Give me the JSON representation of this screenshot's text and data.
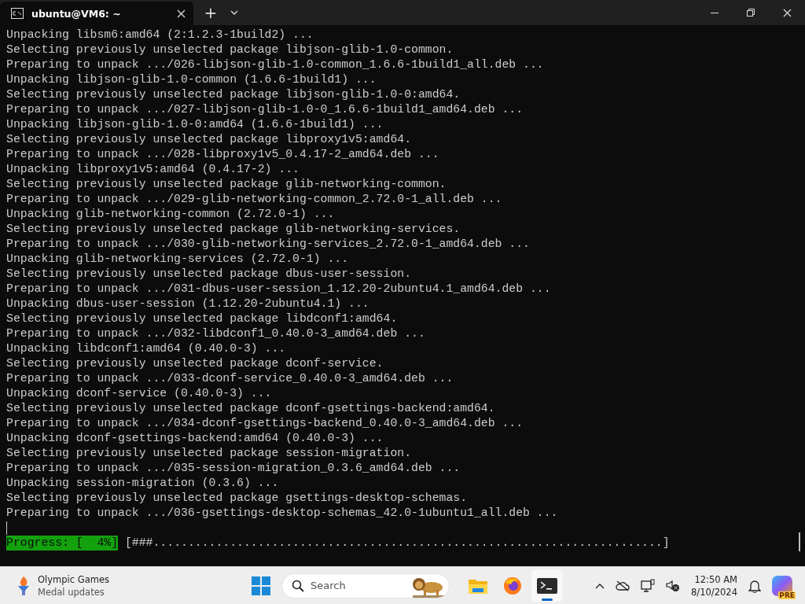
{
  "window": {
    "tab": {
      "title": "ubuntu@VM6: ~",
      "selected": true
    },
    "new_tab": "+"
  },
  "terminal": {
    "lines": [
      "Unpacking libsm6:amd64 (2:1.2.3-1build2) ...",
      "Selecting previously unselected package libjson-glib-1.0-common.",
      "Preparing to unpack .../026-libjson-glib-1.0-common_1.6.6-1build1_all.deb ...",
      "Unpacking libjson-glib-1.0-common (1.6.6-1build1) ...",
      "Selecting previously unselected package libjson-glib-1.0-0:amd64.",
      "Preparing to unpack .../027-libjson-glib-1.0-0_1.6.6-1build1_amd64.deb ...",
      "Unpacking libjson-glib-1.0-0:amd64 (1.6.6-1build1) ...",
      "Selecting previously unselected package libproxy1v5:amd64.",
      "Preparing to unpack .../028-libproxy1v5_0.4.17-2_amd64.deb ...",
      "Unpacking libproxy1v5:amd64 (0.4.17-2) ...",
      "Selecting previously unselected package glib-networking-common.",
      "Preparing to unpack .../029-glib-networking-common_2.72.0-1_all.deb ...",
      "Unpacking glib-networking-common (2.72.0-1) ...",
      "Selecting previously unselected package glib-networking-services.",
      "Preparing to unpack .../030-glib-networking-services_2.72.0-1_amd64.deb ...",
      "Unpacking glib-networking-services (2.72.0-1) ...",
      "Selecting previously unselected package dbus-user-session.",
      "Preparing to unpack .../031-dbus-user-session_1.12.20-2ubuntu4.1_amd64.deb ...",
      "Unpacking dbus-user-session (1.12.20-2ubuntu4.1) ...",
      "Selecting previously unselected package libdconf1:amd64.",
      "Preparing to unpack .../032-libdconf1_0.40.0-3_amd64.deb ...",
      "Unpacking libdconf1:amd64 (0.40.0-3) ...",
      "Selecting previously unselected package dconf-service.",
      "Preparing to unpack .../033-dconf-service_0.40.0-3_amd64.deb ...",
      "Unpacking dconf-service (0.40.0-3) ...",
      "Selecting previously unselected package dconf-gsettings-backend:amd64.",
      "Preparing to unpack .../034-dconf-gsettings-backend_0.40.0-3_amd64.deb ...",
      "Unpacking dconf-gsettings-backend:amd64 (0.40.0-3) ...",
      "Selecting previously unselected package session-migration.",
      "Preparing to unpack .../035-session-migration_0.3.6_amd64.deb ...",
      "Unpacking session-migration (0.3.6) ...",
      "Selecting previously unselected package gsettings-desktop-schemas.",
      "Preparing to unpack .../036-gsettings-desktop-schemas_42.0-1ubuntu1_all.deb ..."
    ],
    "progress_label": "Progress: [  4%]",
    "progress_bar": "[###.........................................................................]"
  },
  "taskbar": {
    "widget": {
      "title": "Olympic Games",
      "subtitle": "Medal updates"
    },
    "search": {
      "placeholder": "Search"
    },
    "apps": [
      {
        "kind": "folder",
        "active": false
      },
      {
        "kind": "browser",
        "active": false
      },
      {
        "kind": "terminal",
        "active": true
      }
    ],
    "clock": {
      "time": "12:50 AM",
      "date": "8/10/2024"
    },
    "copilot_badge": "PRE"
  }
}
